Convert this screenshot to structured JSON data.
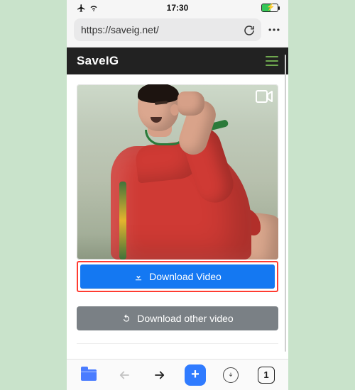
{
  "status": {
    "time": "17:30"
  },
  "browser": {
    "url": "https://saveig.net/",
    "tab_count": "1"
  },
  "site": {
    "logo": "SaveIG"
  },
  "buttons": {
    "download_video": "Download Video",
    "download_other": "Download other video"
  }
}
